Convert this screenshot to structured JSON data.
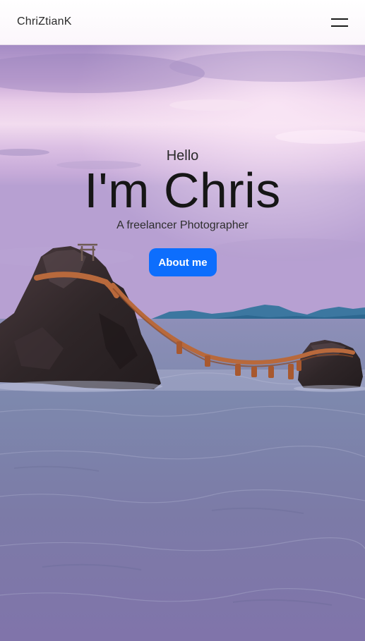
{
  "navbar": {
    "brand": "ChriZtianK",
    "menu_icon": "hamburger-menu-icon"
  },
  "hero": {
    "greeting": "Hello",
    "headline": "I'm Chris",
    "subtitle": "A freelancer Photographer",
    "button_label": "About me",
    "background_image": "Meoto Iwa wedded rocks linked by a sacred rope at sea under a purple sky"
  },
  "colors": {
    "accent": "#0d6efd",
    "sky_top": "#a48cc4",
    "sky_glow": "#ecd2ec",
    "sea": "#7c7ba7",
    "rope": "#b8693c"
  }
}
